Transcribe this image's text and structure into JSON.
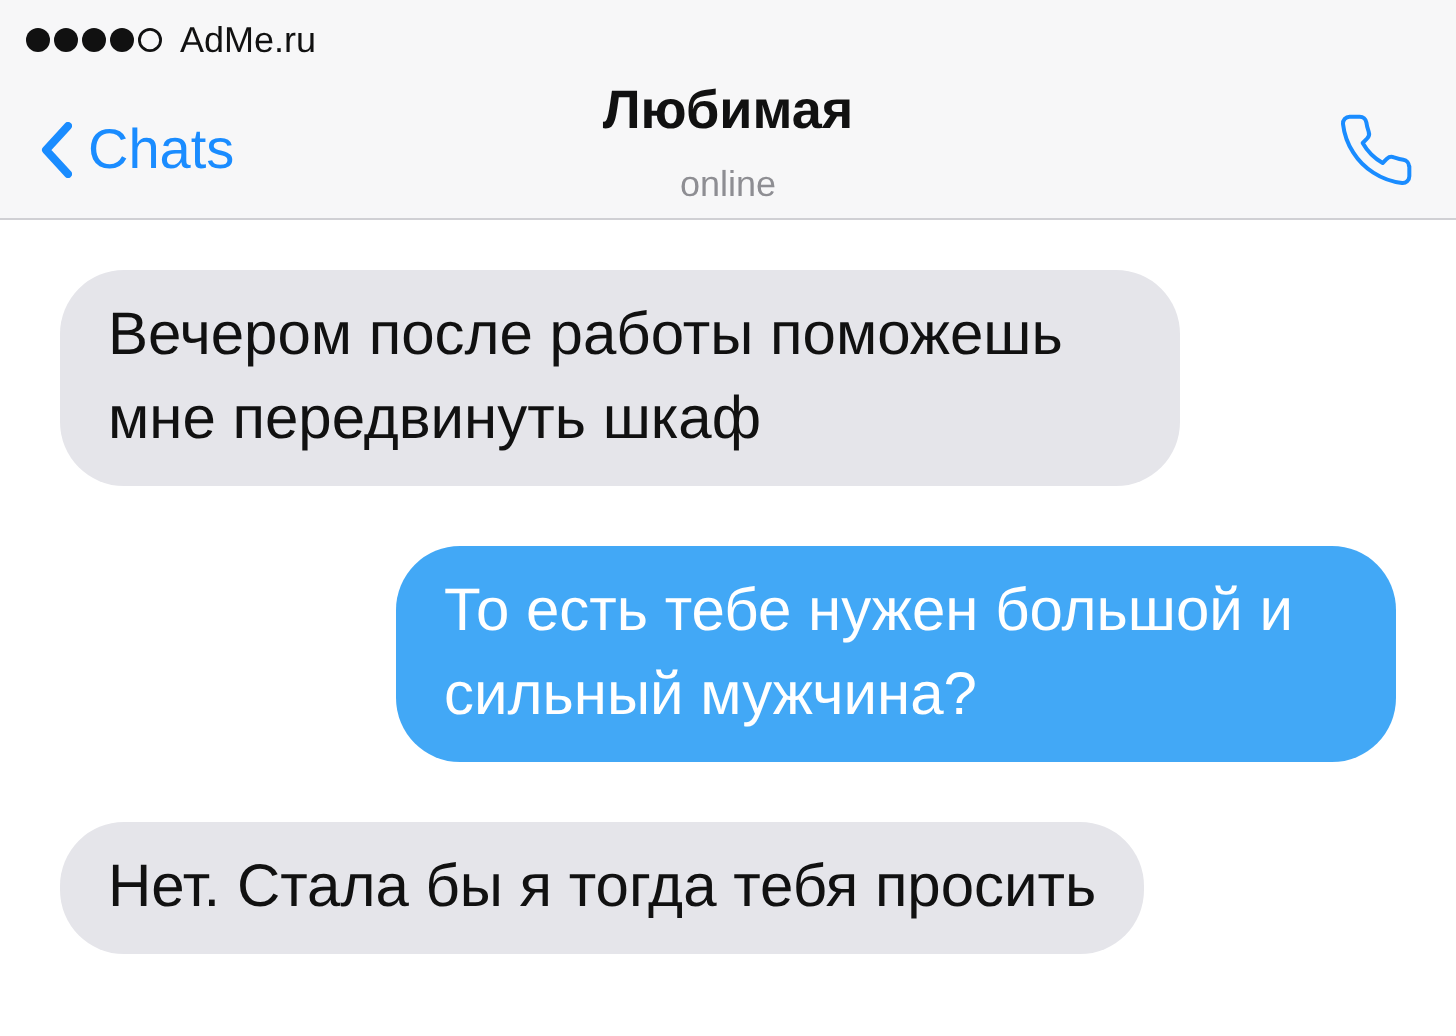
{
  "status_bar": {
    "carrier": "AdMe.ru"
  },
  "header": {
    "back": "Chats",
    "title": "Любимая",
    "subtitle": "online"
  },
  "messages": [
    {
      "text": "Вечером после работы поможешь мне передвинуть шкаф",
      "kind": "incoming"
    },
    {
      "text": "То есть тебе нужен большой и сильный мужчина?",
      "kind": "outgoing"
    },
    {
      "text": "Нет. Стала бы я тогда тебя просить",
      "kind": "incoming"
    }
  ]
}
